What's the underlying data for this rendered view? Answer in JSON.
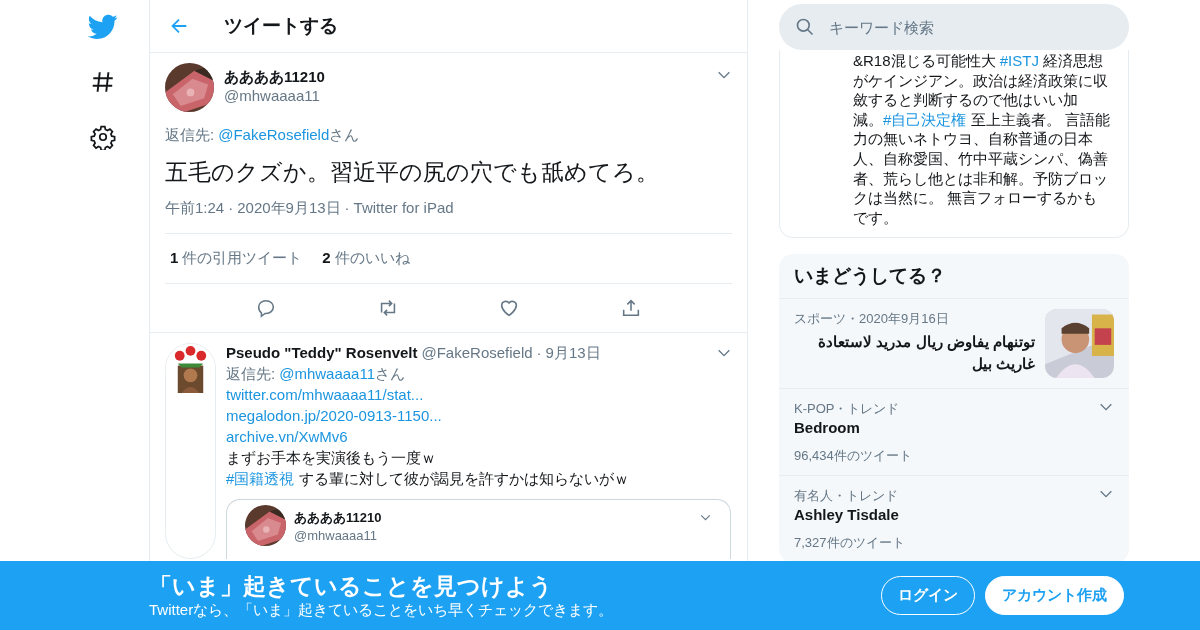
{
  "nav": {
    "items": [
      {
        "kind": "logo"
      },
      {
        "kind": "hashtag"
      },
      {
        "kind": "settings"
      }
    ]
  },
  "header": {
    "title": "ツイートする"
  },
  "main_tweet": {
    "name": "ああああ11210",
    "handle": "@mhwaaaa11",
    "reply_label": "返信先:",
    "reply_to": "@FakeRosefield",
    "reply_suffix": "さん",
    "text": "五毛のクズか。習近平の尻の穴でも舐めてろ。",
    "time": "午前1:24",
    "separator": "·",
    "date": "2020年9月13日",
    "source": "Twitter for iPad",
    "stats": [
      {
        "count": "1",
        "label": "件の引用ツイート"
      },
      {
        "count": "2",
        "label": "件のいいね"
      }
    ],
    "actions": [
      {
        "kind": "reply"
      },
      {
        "kind": "retweet"
      },
      {
        "kind": "like"
      },
      {
        "kind": "share"
      }
    ]
  },
  "reply_tweet": {
    "name": "Pseudo \"Teddy\" Rosenvelt",
    "handle": "@FakeRosefield",
    "separator": "·",
    "date": "9月13日",
    "reply_label": "返信先:",
    "reply_to": "@mhwaaaa11",
    "reply_suffix": "さん",
    "lines": [
      [
        {
          "kind": "link",
          "text": "twitter.com/mhwaaaa11/stat..."
        }
      ],
      [
        {
          "kind": "link",
          "text": "megalodon.jp/2020-0913-1150..."
        }
      ],
      [
        {
          "kind": "link",
          "text": "archive.vn/XwMv6"
        }
      ],
      [
        {
          "kind": "text",
          "text": "まずお手本を実演後もう一度ｗ"
        }
      ],
      [
        {
          "kind": "link",
          "text": "#国籍透視"
        },
        {
          "kind": "text",
          "text": " する輩に対して彼が謁見を許すかは知らないがｗ"
        }
      ]
    ],
    "quoted": {
      "name": "ああああ11210",
      "handle": "@mhwaaaa11"
    }
  },
  "search": {
    "placeholder": "キーワード検索"
  },
  "bio": [
    [
      {
        "kind": "text",
        "text": "&R18混じる可能性大 "
      },
      {
        "kind": "link",
        "text": "#ISTJ"
      },
      {
        "kind": "text",
        "text": " 経済思想"
      }
    ],
    [
      {
        "kind": "text",
        "text": "がケインジアン。政治は経済政策に収"
      }
    ],
    [
      {
        "kind": "text",
        "text": "斂すると判断するので他はいい加"
      }
    ],
    [
      {
        "kind": "text",
        "text": "減。"
      },
      {
        "kind": "link",
        "text": "#自己決定権"
      },
      {
        "kind": "text",
        "text": " 至上主義者。 言語能"
      }
    ],
    [
      {
        "kind": "text",
        "text": "力の無いネトウヨ、自称普通の日本"
      }
    ],
    [
      {
        "kind": "text",
        "text": "人、自称愛国、竹中平蔵シンパ、偽善"
      }
    ],
    [
      {
        "kind": "text",
        "text": "者、荒らし他とは非和解。予防ブロッ"
      }
    ],
    [
      {
        "kind": "text",
        "text": "クは当然に。 無言フォローするかも"
      }
    ],
    [
      {
        "kind": "text",
        "text": "です。"
      }
    ]
  ],
  "trends": {
    "title": "いまどうしてる？",
    "items": [
      {
        "kind": "news",
        "meta": "スポーツ・2020年9月16日",
        "headline": "توتنهام يفاوض ريال مدريد لاستعادة غاريث بيل"
      },
      {
        "kind": "trend",
        "meta": "K-POP・トレンド",
        "topic": "Bedroom",
        "count": "96,434件のツイート"
      },
      {
        "kind": "trend",
        "meta": "有名人・トレンド",
        "topic": "Ashley Tisdale",
        "count": "7,327件のツイート"
      }
    ]
  },
  "banner": {
    "title": "「いま」起きていることを見つけよう",
    "subtitle": "Twitterなら、「いま」起きていることをいち早くチェックできます。",
    "buttons": [
      {
        "kind": "outline",
        "label": "ログイン"
      },
      {
        "kind": "filled",
        "label": "アカウント作成"
      }
    ]
  }
}
